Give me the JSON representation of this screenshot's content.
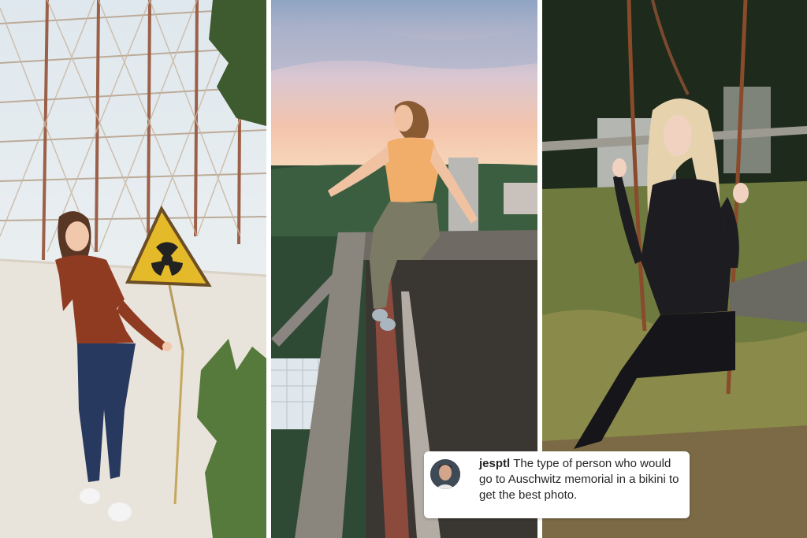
{
  "comment": {
    "username": "jesptl",
    "text": "The type of person who would go to Auschwitz memorial in a bikini to get the best photo."
  },
  "panels": [
    {
      "icon": "radiation-warning-sign-icon"
    },
    {
      "icon": "rooftop-scene"
    },
    {
      "icon": "swing-scene"
    }
  ]
}
